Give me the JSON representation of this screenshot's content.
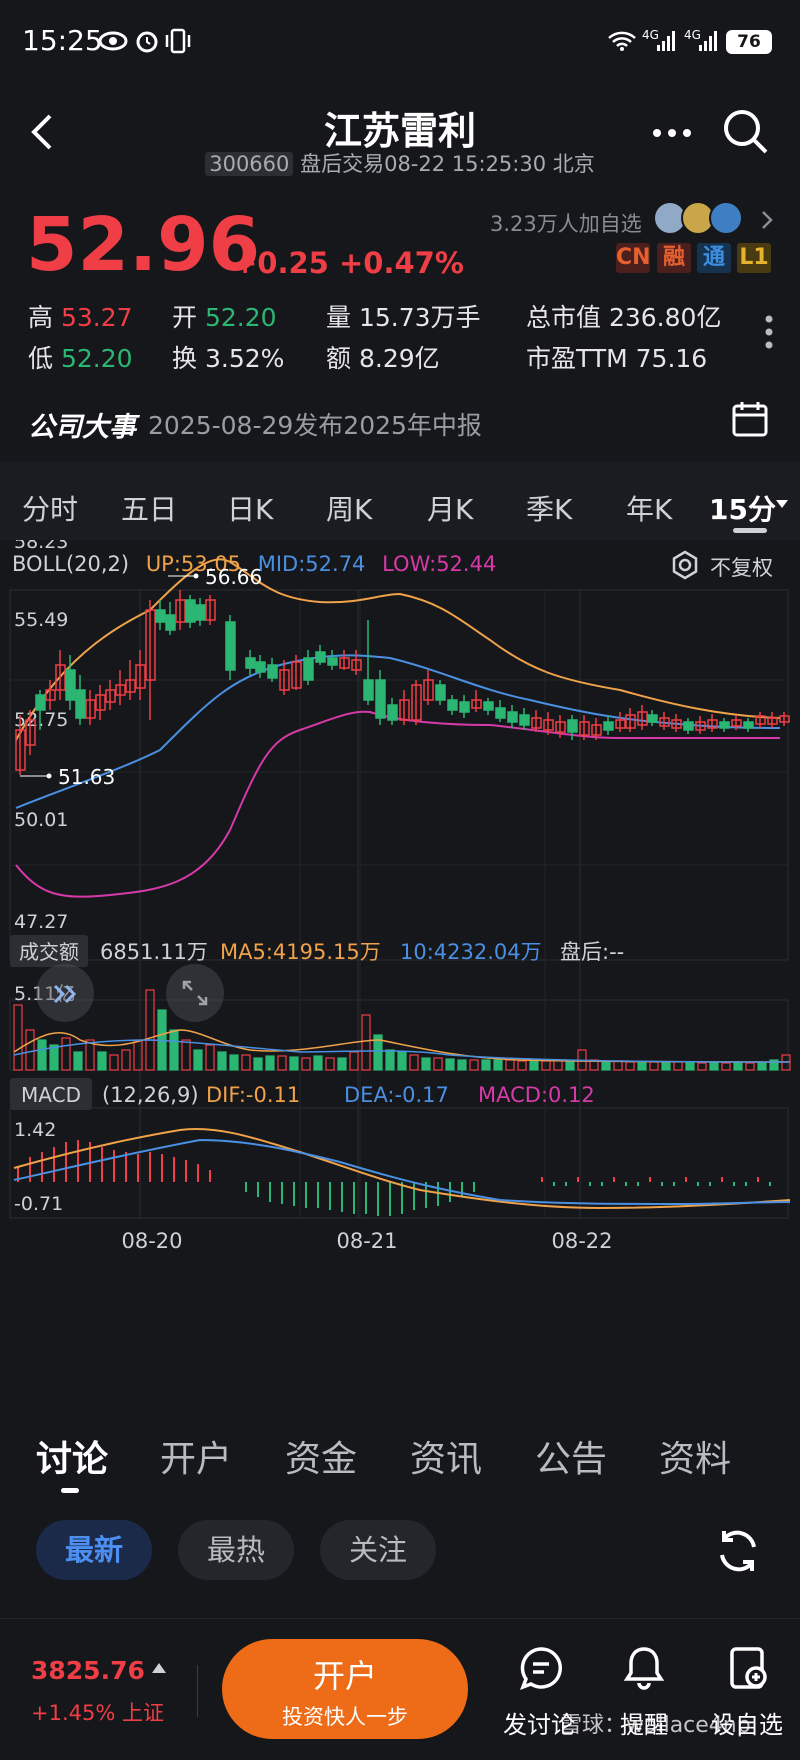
{
  "status": {
    "time": "15:25",
    "battery": "76",
    "net1": "4G",
    "net2": "4G"
  },
  "header": {
    "title": "江苏雷利",
    "code": "300660",
    "subtitle": "盘后交易08-22 15:25:30 北京"
  },
  "quote": {
    "price": "52.96",
    "change": "+0.25",
    "change_pct": "+0.47%",
    "followers": "3.23万人加自选",
    "badges": [
      "CN",
      "融",
      "通",
      "L1"
    ],
    "high_label": "高",
    "high": "53.27",
    "open_label": "开",
    "open": "52.20",
    "vol_label": "量",
    "vol": "15.73万手",
    "mcap_label": "总市值",
    "mcap": "236.80亿",
    "low_label": "低",
    "low": "52.20",
    "turn_label": "换",
    "turn": "3.52%",
    "amt_label": "额",
    "amt": "8.29亿",
    "pe_label": "市盈TTM",
    "pe": "75.16"
  },
  "event": {
    "label": "公司大事",
    "text": "2025-08-29发布2025年中报"
  },
  "periods": [
    "分时",
    "五日",
    "日K",
    "周K",
    "月K",
    "季K",
    "年K",
    "15分"
  ],
  "boll": {
    "name": "BOLL(20,2)",
    "up": "UP:53.05",
    "mid": "MID:52.74",
    "low": "LOW:52.44",
    "adjust": "不复权"
  },
  "price_axis": [
    "58.23",
    "55.49",
    "52.75",
    "50.01",
    "47.27"
  ],
  "marks": {
    "high": "56.66",
    "low": "51.63"
  },
  "volume": {
    "label": "成交额",
    "value": "6851.11万",
    "ma5": "MA5:4195.15万",
    "ma10": "10:4232.04万",
    "after": "盘后:--",
    "axis_top": "5.11亿"
  },
  "macd": {
    "label": "MACD",
    "params": "(12,26,9)",
    "dif": "DIF:-0.11",
    "dea": "DEA:-0.17",
    "macd": "MACD:0.12",
    "axis_top": "1.42",
    "axis_bottom": "-0.71"
  },
  "dates": [
    "08-20",
    "08-21",
    "08-22"
  ],
  "bottom_tabs": [
    "讨论",
    "开户",
    "资金",
    "资讯",
    "公告",
    "资料"
  ],
  "filters": [
    "最新",
    "最热",
    "关注"
  ],
  "footer": {
    "index_value": "3825.76",
    "index_change": "+1.45% 上证",
    "cta_title": "开户",
    "cta_sub": "投资快人一步",
    "actions": [
      "发讨论",
      "提醒",
      "设自选"
    ],
    "watermark": "雪球：wallace4np"
  },
  "colors": {
    "up": "#ef3e46",
    "down": "#2bb673",
    "boll_up": "#f0a24a",
    "boll_mid": "#4a90e2",
    "boll_low": "#d63aa8",
    "accent": "#ee6b18"
  }
}
